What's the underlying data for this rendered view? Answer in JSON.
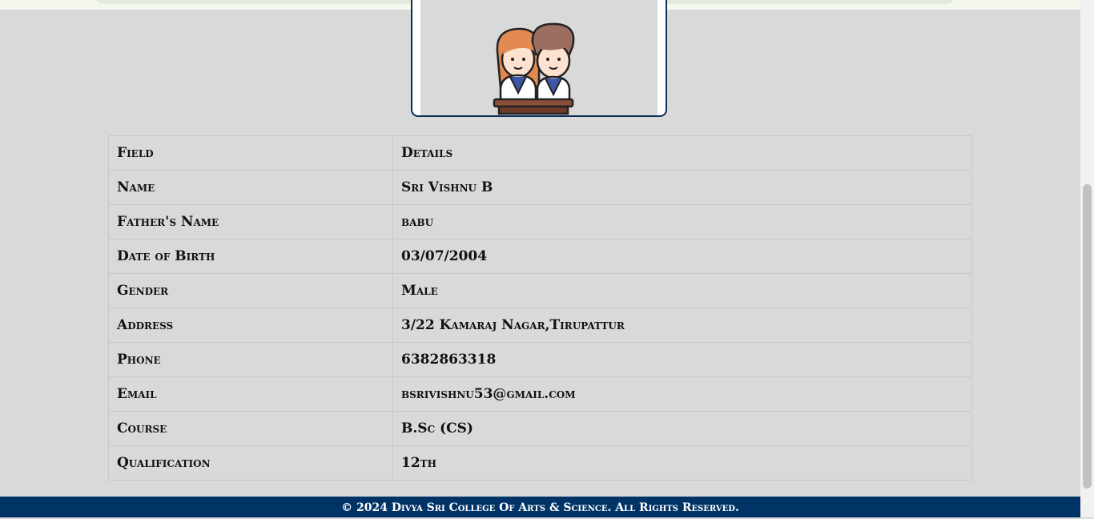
{
  "table": {
    "header": {
      "field": "Field",
      "details": "Details"
    },
    "rows": [
      {
        "field": "Name",
        "value": "Sri Vishnu B"
      },
      {
        "field": "Father's Name",
        "value": "babu"
      },
      {
        "field": "Date of Birth",
        "value": "03/07/2004"
      },
      {
        "field": "Gender",
        "value": "Male"
      },
      {
        "field": "Address",
        "value": "3/22 Kamaraj Nagar,Tirupattur"
      },
      {
        "field": "Phone",
        "value": "6382863318"
      },
      {
        "field": "Email",
        "value": "bsrivishnu53@gmail.com"
      },
      {
        "field": "Course",
        "value": "B.Sc (CS)"
      },
      {
        "field": "Qualification",
        "value": "12th"
      }
    ]
  },
  "footer": {
    "text": "© 2024 Divya Sri College Of Arts & Science. All Rights Reserved."
  },
  "profile_image": {
    "icon": "students-icon"
  },
  "colors": {
    "footer_bg": "#003366",
    "frame_border": "#0b2e59",
    "page_bg": "#d9d9d9"
  }
}
